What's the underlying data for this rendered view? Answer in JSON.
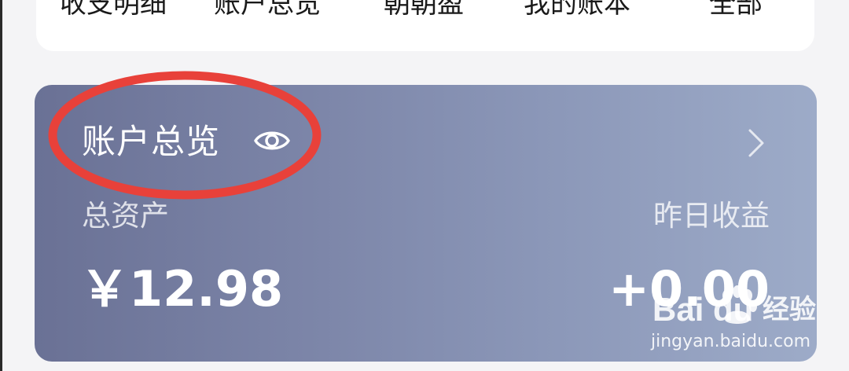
{
  "tabs": [
    {
      "label": "收支明细"
    },
    {
      "label": "账户总览"
    },
    {
      "label": "朝朝盈"
    },
    {
      "label": "我的账本"
    },
    {
      "label": "全部"
    }
  ],
  "account_card": {
    "title": "账户总览",
    "eye_icon": "eye-icon",
    "chevron_icon": "chevron-right-icon",
    "total_assets_label": "总资产",
    "total_assets_value": "￥12.98",
    "yesterday_income_label": "昨日收益",
    "yesterday_income_value": "+0.00"
  },
  "annotation": {
    "color": "#e8413a"
  },
  "watermark": {
    "logo": "Bai du",
    "brand": "经验",
    "url": "jingyan.baidu.com"
  }
}
